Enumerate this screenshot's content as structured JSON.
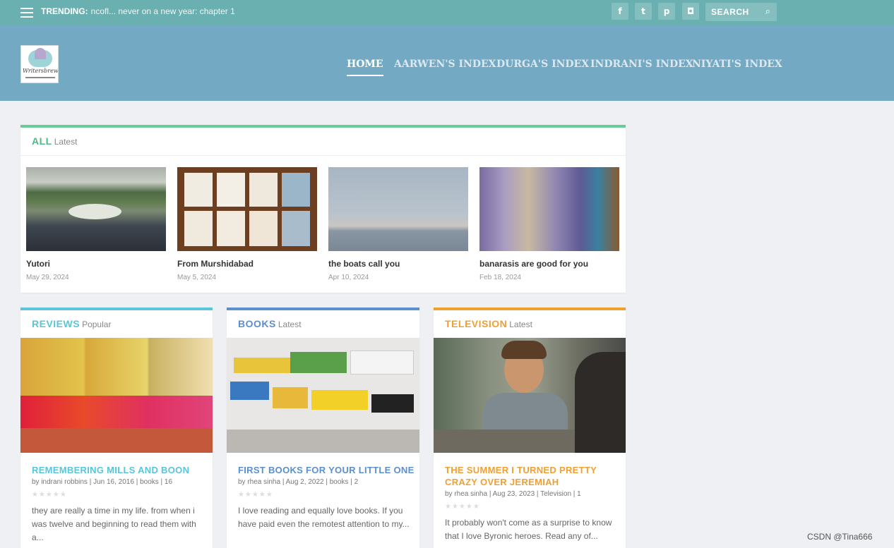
{
  "topbar": {
    "trending_label": "TRENDING:",
    "trending_text": "ncofl... never on a new year: chapter 1",
    "social": [
      {
        "icon": "facebook-icon",
        "glyph": "f"
      },
      {
        "icon": "twitter-icon",
        "glyph": "t"
      },
      {
        "icon": "pinterest-icon",
        "glyph": "p"
      },
      {
        "icon": "instagram-icon",
        "glyph": "◘"
      }
    ],
    "search_placeholder": "SEARCH",
    "search_glyph": "⌕"
  },
  "header": {
    "logo_text": "Writersbrew",
    "nav": [
      "HOME",
      "AARWEN'S INDEX",
      "DURGA'S INDEX",
      "INDRANI'S INDEX",
      "NIYATI'S INDEX"
    ]
  },
  "all": {
    "title": "ALL",
    "subtitle": "Latest",
    "accent": "#66cc99",
    "posts": [
      {
        "title": "Yutori",
        "date": "May 29, 2024"
      },
      {
        "title": "From Murshidabad",
        "date": "May 5, 2024"
      },
      {
        "title": "the boats call you",
        "date": "Apr 10, 2024"
      },
      {
        "title": "banarasis are good for you",
        "date": "Feb 18, 2024"
      }
    ]
  },
  "reviews": {
    "title": "REVIEWS",
    "subtitle": "Popular",
    "accent": "#58c5d8",
    "post_title": "REMEMBERING MILLS AND BOON",
    "meta": "by indrani robbins | Jun 16, 2016 | books | 16",
    "stars": "★★★★★",
    "excerpt": "they are really a time in my life. from when i was twelve and beginning to read them with a..."
  },
  "books": {
    "title": "BOOKS",
    "subtitle": "Latest",
    "accent": "#5b8fcf",
    "post_title": "FIRST BOOKS FOR YOUR LITTLE ONE",
    "meta": "by rhea sinha | Aug 2, 2022 | books | 2",
    "stars": "★★★★★",
    "excerpt": "I love reading and equally love books. If you have paid even the remotest attention to my..."
  },
  "television": {
    "title": "TELEVISION",
    "subtitle": "Latest",
    "accent": "#f0a030",
    "post_title": "THE SUMMER I TURNED PRETTY CRAZY OVER JEREMIAH",
    "meta": "by rhea sinha | Aug 23, 2023 | Television | 1",
    "stars": "★★★★★",
    "excerpt": "It probably won't come as a surprise to know that I love Byronic heroes. Read any of..."
  },
  "watermark": "CSDN @Tina666"
}
